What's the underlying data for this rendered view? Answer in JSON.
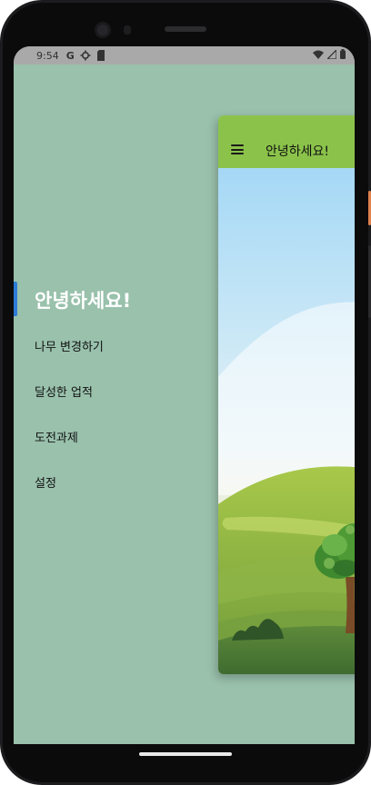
{
  "status_bar": {
    "time": "9:54",
    "left_icons": [
      "google-icon",
      "settings-icon",
      "sd-card-icon"
    ],
    "right_icons": [
      "wifi-icon",
      "signal-icon",
      "battery-icon"
    ]
  },
  "drawer": {
    "title": "안녕하세요!",
    "items": [
      {
        "label": "나무 변경하기"
      },
      {
        "label": "달성한 업적"
      },
      {
        "label": "도전과제"
      },
      {
        "label": "설정"
      }
    ]
  },
  "main": {
    "app_bar_title": "안녕하세요!",
    "menu_icon": "hamburger-menu-icon",
    "illustration": "tree-landscape-illustration"
  },
  "colors": {
    "drawer_background": "#99c1ac",
    "app_bar": "#8bc34a",
    "selected_indicator": "#2d7bd6",
    "sky": "#9ed6f4",
    "hills": "#8fb840"
  }
}
